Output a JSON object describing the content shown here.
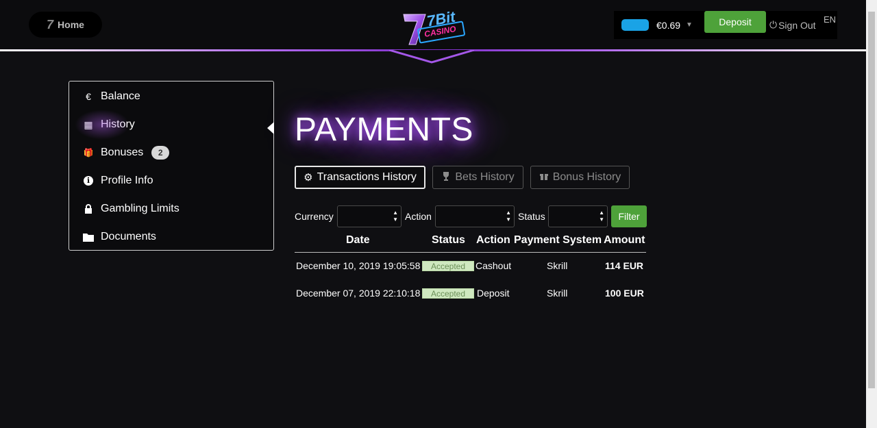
{
  "header": {
    "home_label": "Home",
    "home_glyph": "7",
    "logo_text_top": "7Bit",
    "logo_text_bottom": "CASINO",
    "balance": "€0.69",
    "deposit_label": "Deposit",
    "signout_label": "Sign Out",
    "language": "EN",
    "currency_chip_color": "#1aa3e6",
    "accent_color": "#8e3ee0"
  },
  "sidebar": {
    "items": [
      {
        "label": "Balance",
        "icon": "euro-icon",
        "glyph": "€"
      },
      {
        "label": "History",
        "icon": "calendar-icon",
        "glyph": "▦"
      },
      {
        "label": "Bonuses",
        "icon": "gift-icon",
        "glyph": "🎁",
        "badge": "2"
      },
      {
        "label": "Profile Info",
        "icon": "info-icon",
        "glyph": "ℹ"
      },
      {
        "label": "Gambling Limits",
        "icon": "lock-icon",
        "glyph": "🔒"
      },
      {
        "label": "Documents",
        "icon": "folder-icon",
        "glyph": "📁"
      }
    ],
    "active": "History"
  },
  "main": {
    "title": "PAYMENTS",
    "tabs": [
      {
        "label": "Transactions History",
        "icon": "gear-icon",
        "active": true
      },
      {
        "label": "Bets History",
        "icon": "trophy-icon",
        "active": false
      },
      {
        "label": "Bonus History",
        "icon": "gift-icon",
        "active": false
      }
    ],
    "filters": {
      "currency_label": "Currency",
      "action_label": "Action",
      "status_label": "Status",
      "filter_button": "Filter"
    },
    "table": {
      "columns": [
        "Date",
        "Status",
        "Action",
        "Payment System",
        "Amount"
      ],
      "rows": [
        {
          "date": "December 10, 2019 19:05:58",
          "status": "Accepted",
          "action": "Cashout",
          "payment_system": "Skrill",
          "amount": "114 EUR"
        },
        {
          "date": "December 07, 2019 22:10:18",
          "status": "Accepted",
          "action": "Deposit",
          "payment_system": "Skrill",
          "amount": "100 EUR"
        }
      ]
    }
  }
}
